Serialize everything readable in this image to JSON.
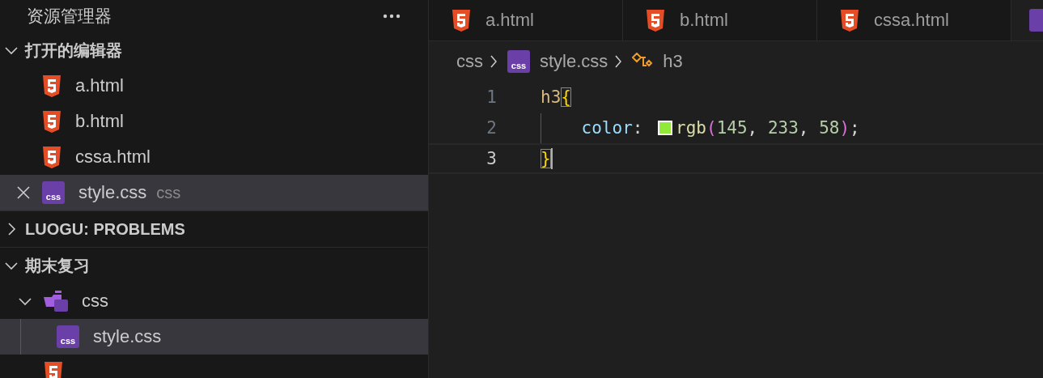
{
  "sidebar": {
    "title": "资源管理器",
    "sections": [
      {
        "label": "打开的编辑器",
        "expanded": true,
        "items": [
          {
            "name": "a.html",
            "kind": "html",
            "selected": false,
            "closable": false
          },
          {
            "name": "b.html",
            "kind": "html",
            "selected": false,
            "closable": false
          },
          {
            "name": "cssa.html",
            "kind": "html",
            "selected": false,
            "closable": false
          },
          {
            "name": "style.css",
            "kind": "css",
            "selected": true,
            "closable": true,
            "detail": "css"
          }
        ]
      },
      {
        "label": "LUOGU: PROBLEMS",
        "expanded": false
      },
      {
        "label": "期末复习",
        "expanded": true,
        "items": [
          {
            "name": "css",
            "kind": "folder",
            "selected": false,
            "expanded": true,
            "children": [
              {
                "name": "style.css",
                "kind": "css",
                "selected": true
              }
            ]
          },
          {
            "kind": "html",
            "selected": false
          }
        ]
      }
    ]
  },
  "tabs": [
    {
      "name": "a.html",
      "kind": "html",
      "selected": false
    },
    {
      "name": "b.html",
      "kind": "html",
      "selected": false
    },
    {
      "name": "cssa.html",
      "kind": "html",
      "selected": false
    },
    {
      "kind": "css",
      "selected": true
    }
  ],
  "breadcrumb": [
    {
      "text": "css",
      "kind": "folder"
    },
    {
      "text": "style.css",
      "kind": "css"
    },
    {
      "text": "h3",
      "kind": "symbol"
    }
  ],
  "code": [
    {
      "number": "1",
      "current": false,
      "tokens": [
        {
          "kind": "selector",
          "text": "h3"
        },
        {
          "kind": "bracket",
          "text": "{",
          "matched": true
        }
      ]
    },
    {
      "number": "2",
      "current": false,
      "tokens": [
        {
          "kind": "indent"
        },
        {
          "kind": "property",
          "text": "color"
        },
        {
          "kind": "punct",
          "text": ": "
        },
        {
          "kind": "swatch",
          "color": "#91e93a"
        },
        {
          "kind": "function",
          "text": "rgb"
        },
        {
          "kind": "paren",
          "text": "("
        },
        {
          "kind": "number",
          "text": "145"
        },
        {
          "kind": "punct",
          "text": ", "
        },
        {
          "kind": "number",
          "text": "233"
        },
        {
          "kind": "punct",
          "text": ", "
        },
        {
          "kind": "number",
          "text": "58"
        },
        {
          "kind": "paren",
          "text": ")"
        },
        {
          "kind": "punct",
          "text": ";"
        }
      ]
    },
    {
      "number": "3",
      "current": true,
      "tokens": [
        {
          "kind": "bracket",
          "text": "}",
          "matched": true
        }
      ]
    }
  ]
}
